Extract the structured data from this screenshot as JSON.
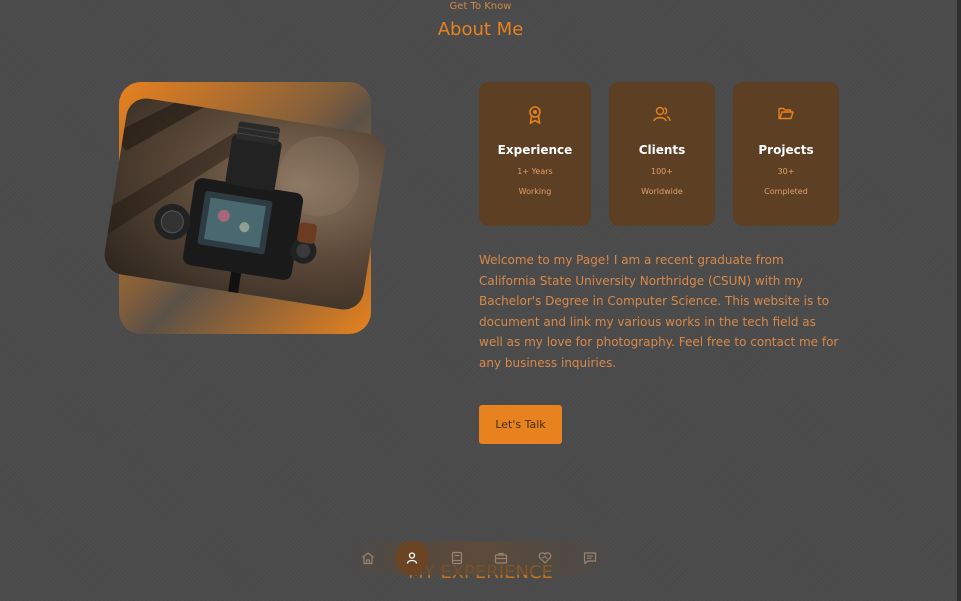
{
  "header": {
    "subtitle": "Get To Know",
    "title": "About Me"
  },
  "cards": [
    {
      "icon": "award-icon",
      "title": "Experience",
      "line1": "1+ Years",
      "line2": "Working"
    },
    {
      "icon": "users-icon",
      "title": "Clients",
      "line1": "100+",
      "line2": "Worldwide"
    },
    {
      "icon": "folder-icon",
      "title": "Projects",
      "line1": "30+",
      "line2": "Completed"
    }
  ],
  "bio": "Welcome to my Page! I am a recent graduate from California State University Northridge (CSUN) with my Bachelor's Degree in Computer Science. This website is to document and link my various works in the tech field as well as my love for photography. Feel free to contact me for any business inquiries.",
  "cta_label": "Let's Talk",
  "next_section": "MY EXPERIENCE",
  "nav": [
    {
      "icon": "home-icon",
      "active": false
    },
    {
      "icon": "user-icon",
      "active": true
    },
    {
      "icon": "book-icon",
      "active": false
    },
    {
      "icon": "briefcase-icon",
      "active": false
    },
    {
      "icon": "heart-handshake-icon",
      "active": false
    },
    {
      "icon": "message-icon",
      "active": false
    }
  ],
  "colors": {
    "accent": "#e8821e",
    "card_bg": "#5d3f24",
    "background": "#4b4b4b"
  }
}
